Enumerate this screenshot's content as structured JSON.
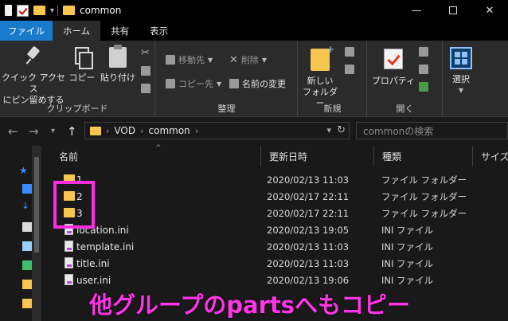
{
  "window": {
    "title": "common",
    "minimize": "—",
    "close": "✕"
  },
  "tabs": [
    "ファイル",
    "ホーム",
    "共有",
    "表示"
  ],
  "ribbon": {
    "clipboard": {
      "label": "クリップボード",
      "pin_line1": "クイック アクセス",
      "pin_line2": "にピン留めする",
      "copy": "コピー",
      "paste": "貼り付け"
    },
    "organize": {
      "label": "整理",
      "move_to": "移動先",
      "copy_to": "コピー先",
      "delete": "削除",
      "rename": "名前の変更"
    },
    "new": {
      "label": "新規",
      "new_folder_line1": "新しい",
      "new_folder_line2": "フォルダー"
    },
    "open": {
      "label": "開く",
      "properties": "プロパティ"
    },
    "select": {
      "label": "選択"
    }
  },
  "address": {
    "path": [
      "VOD",
      "common"
    ],
    "search_placeholder": "commonの検索"
  },
  "columns": {
    "name": "名前",
    "modified": "更新日時",
    "type": "種類",
    "size": "サイズ"
  },
  "files": [
    {
      "name": "1",
      "modified": "2020/02/13 11:03",
      "type": "ファイル フォルダー",
      "kind": "folder"
    },
    {
      "name": "2",
      "modified": "2020/02/17 22:11",
      "type": "ファイル フォルダー",
      "kind": "folder"
    },
    {
      "name": "3",
      "modified": "2020/02/17 22:11",
      "type": "ファイル フォルダー",
      "kind": "folder"
    },
    {
      "name": "location.ini",
      "modified": "2020/02/13 19:05",
      "type": "INI ファイル",
      "kind": "ini"
    },
    {
      "name": "template.ini",
      "modified": "2020/02/13 11:03",
      "type": "INI ファイル",
      "kind": "ini"
    },
    {
      "name": "title.ini",
      "modified": "2020/02/13 11:03",
      "type": "INI ファイル",
      "kind": "ini"
    },
    {
      "name": "user.ini",
      "modified": "2020/02/13 19:06",
      "type": "INI ファイル",
      "kind": "ini"
    }
  ],
  "annotation": {
    "overlay_text": "他グループのpartsへもコピー",
    "highlight_color": "#ff2be0",
    "text_color": "#ff35e6"
  },
  "colors": {
    "folder": "#f6c64e",
    "file_tab": "#1979ca",
    "background": "#191919",
    "ribbon": "#2b2b2b"
  }
}
